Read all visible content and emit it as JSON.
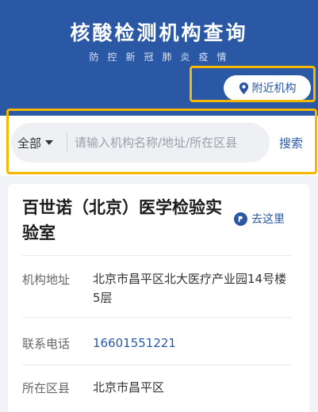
{
  "header": {
    "title": "核酸检测机构查询",
    "subtitle": "防控新冠肺炎疫情",
    "nearby_label": "附近机构"
  },
  "search": {
    "filter_label": "全部",
    "placeholder": "请输入机构名称/地址/所在区县",
    "search_label": "搜索"
  },
  "institution": {
    "name": "百世诺（北京）医学检验实验室",
    "goto_label": "去这里",
    "address_label": "机构地址",
    "address": "北京市昌平区北大医疗产业园14号楼5层",
    "phone_label": "联系电话",
    "phone": "16601551221",
    "district_label": "所在区县",
    "district": "北京市昌平区"
  },
  "colors": {
    "brand_blue": "#2a58a5",
    "highlight": "#f5b800"
  },
  "icons": {
    "nearby": "location-pin-icon",
    "filter": "caret-down-icon",
    "goto": "navigation-icon"
  }
}
